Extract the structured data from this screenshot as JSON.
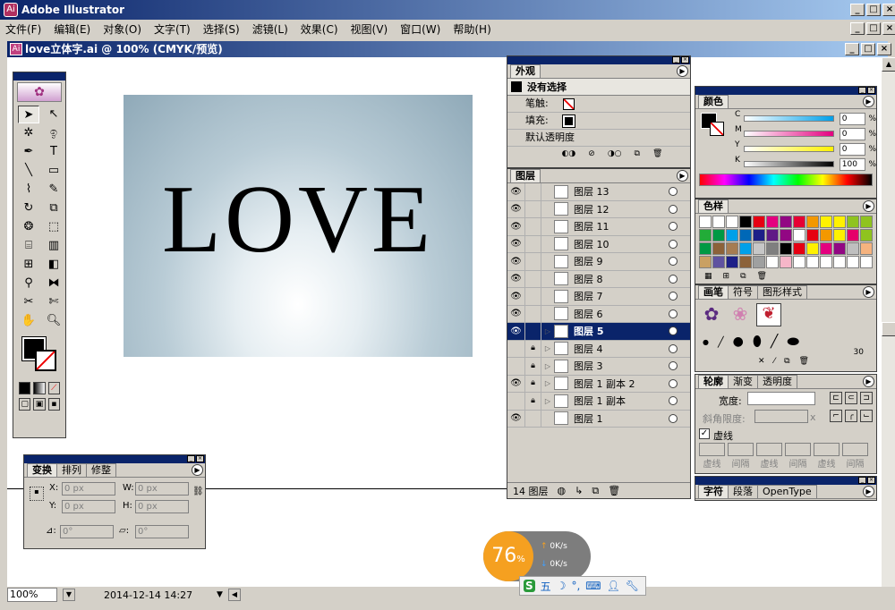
{
  "app": {
    "title": "Adobe Illustrator"
  },
  "menu": [
    "文件(F)",
    "编辑(E)",
    "对象(O)",
    "文字(T)",
    "选择(S)",
    "滤镜(L)",
    "效果(C)",
    "视图(V)",
    "窗口(W)",
    "帮助(H)"
  ],
  "document": {
    "title": "love立体字.ai @ 100% (CMYK/预览)",
    "artwork_text": "LOVE"
  },
  "status": {
    "zoom": "100%",
    "datetime": "2014-12-14  14:27"
  },
  "transform": {
    "tabs": [
      "变换",
      "排列",
      "修整"
    ],
    "x_label": "X:",
    "x_value": "0 px",
    "y_label": "Y:",
    "y_value": "0 px",
    "w_label": "W:",
    "w_value": "0 px",
    "h_label": "H:",
    "h_value": "0 px",
    "angle_label": "⊿:",
    "angle_value": "0°",
    "shear_label": "▱:",
    "shear_value": "0°"
  },
  "appearance": {
    "tab": "外观",
    "header": "没有选择",
    "stroke_label": "笔触:",
    "fill_label": "填充:",
    "opacity_label": "默认透明度"
  },
  "layers": {
    "tab": "图层",
    "items": [
      {
        "name": "图层 13",
        "visible": true,
        "locked": false,
        "selected": false
      },
      {
        "name": "图层 12",
        "visible": true,
        "locked": false,
        "selected": false
      },
      {
        "name": "图层 11",
        "visible": true,
        "locked": false,
        "selected": false
      },
      {
        "name": "图层 10",
        "visible": true,
        "locked": false,
        "selected": false
      },
      {
        "name": "图层 9",
        "visible": true,
        "locked": false,
        "selected": false
      },
      {
        "name": "图层 8",
        "visible": true,
        "locked": false,
        "selected": false
      },
      {
        "name": "图层 7",
        "visible": true,
        "locked": false,
        "selected": false
      },
      {
        "name": "图层 6",
        "visible": true,
        "locked": false,
        "selected": false
      },
      {
        "name": "图层 5",
        "visible": true,
        "locked": false,
        "selected": true
      },
      {
        "name": "图层 4",
        "visible": false,
        "locked": true,
        "selected": false
      },
      {
        "name": "图层 3",
        "visible": false,
        "locked": true,
        "selected": false
      },
      {
        "name": "图层 1 副本 2",
        "visible": true,
        "locked": true,
        "selected": false
      },
      {
        "name": "图层 1 副本",
        "visible": false,
        "locked": true,
        "selected": false
      },
      {
        "name": "图层 1",
        "visible": true,
        "locked": false,
        "selected": false
      }
    ],
    "count_label": "14 图层"
  },
  "color": {
    "tab": "颜色",
    "channels": [
      {
        "label": "C",
        "value": "0"
      },
      {
        "label": "M",
        "value": "0"
      },
      {
        "label": "Y",
        "value": "0"
      },
      {
        "label": "K",
        "value": "100"
      }
    ],
    "percent": "%"
  },
  "swatches": {
    "tab": "色样",
    "colors": [
      "#ffffff",
      "#ffffff",
      "#ffffff",
      "#000000",
      "#e60012",
      "#e4007f",
      "#920783",
      "#e60033",
      "#f39800",
      "#fff100",
      "#fff100",
      "#8fc31f",
      "#8fc31f",
      "#22ac38",
      "#009944",
      "#00a0e9",
      "#0068b7",
      "#1d2088",
      "#601986",
      "#920783",
      "#ffffff",
      "#e60012",
      "#f39800",
      "#fff100",
      "#e5006a",
      "#8fc31f",
      "#009944",
      "#8c6239",
      "#a67c52",
      "#00a0e9",
      "#c7c7c7",
      "#7f7f7f",
      "#000000",
      "#e60012",
      "#fff100",
      "#e4007f",
      "#920783",
      "#bfbfbf",
      "#f6b37f",
      "#c9a063",
      "#5f52a0",
      "#1d2088",
      "#8c6239",
      "#9fa0a0",
      "#ffffff",
      "#f6b6c9",
      "#ffffff",
      "#ffffff",
      "#ffffff",
      "#ffffff",
      "#ffffff",
      "#ffffff"
    ]
  },
  "brushes": {
    "tabs": [
      "画笔",
      "符号",
      "图形样式"
    ],
    "size_value": "30"
  },
  "outline": {
    "tabs": [
      "轮廓",
      "渐变",
      "透明度"
    ],
    "weight_label": "宽度:",
    "miter_label": "斜角限度:",
    "miter_unit": "x",
    "dash_label": "虚线",
    "dash_fields": [
      "虚线",
      "间隔",
      "虚线",
      "间隔",
      "虚线",
      "间隔"
    ]
  },
  "character": {
    "tabs": [
      "字符",
      "段落",
      "OpenType"
    ]
  },
  "network": {
    "percent": "76",
    "percent_sign": "%",
    "up": "0K/s",
    "down": "0K/s"
  },
  "ime": {
    "label": "五"
  }
}
